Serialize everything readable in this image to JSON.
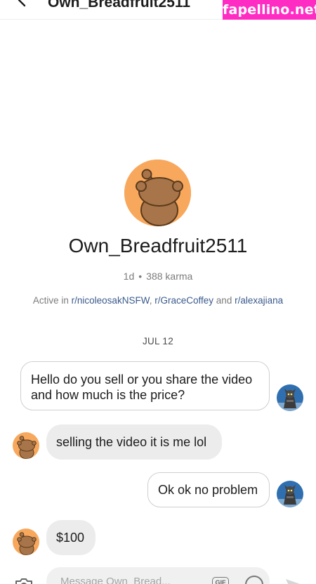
{
  "header": {
    "title": "Own_Breadfruit2511",
    "watermark": "fapellino.net"
  },
  "profile": {
    "username": "Own_Breadfruit2511",
    "age": "1d",
    "separator": "•",
    "karma": "388 karma",
    "active_prefix": "Active in",
    "communities": [
      "r/nicoleosakNSFW",
      "r/GraceCoffey",
      "r/alexajiana"
    ],
    "comma": ",",
    "and_word": "and"
  },
  "chat": {
    "date": "JUL 12",
    "messages": [
      {
        "sender": "self",
        "text": "Hello do you sell or you share the video and how much is the price?"
      },
      {
        "sender": "other",
        "text": "selling the video it is me lol"
      },
      {
        "sender": "self",
        "text": "Ok ok no problem"
      },
      {
        "sender": "other",
        "text": "$100"
      }
    ]
  },
  "composer": {
    "placeholder": "Message Own_Bread...",
    "gif_label": "GIF",
    "icons": [
      "camera-icon",
      "gif-icon",
      "emoji-icon",
      "send-icon"
    ]
  },
  "colors": {
    "avatar_orange": "#f7a85d",
    "bubble_in": "#ececec",
    "link": "#3a5a8c",
    "watermark": "#ff2cc4"
  }
}
